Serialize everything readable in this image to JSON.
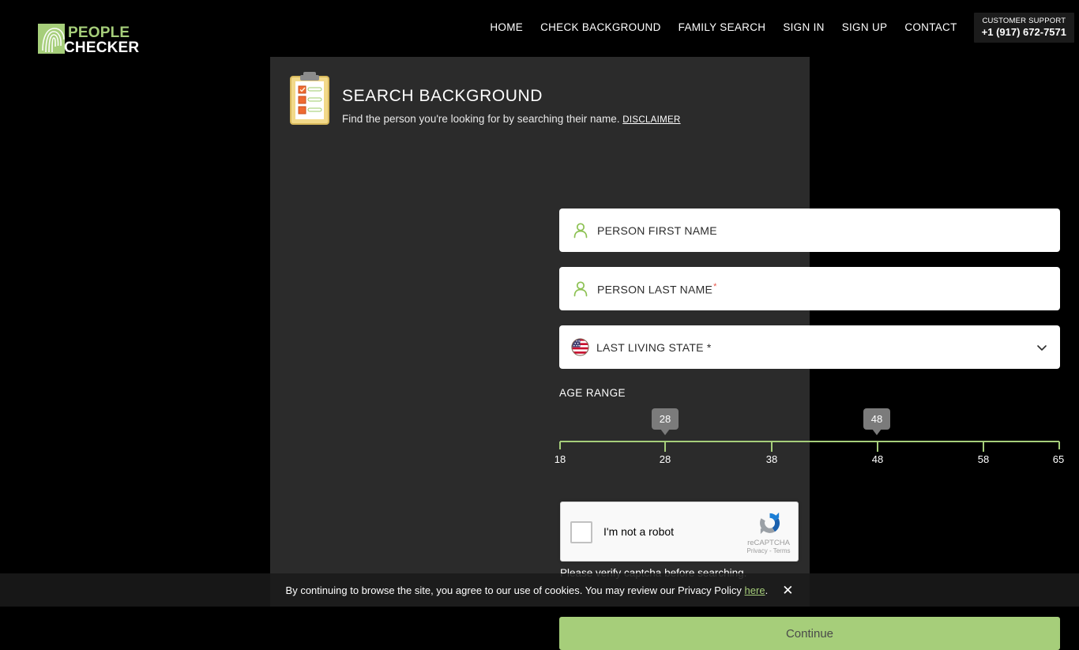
{
  "brand": {
    "name_line1": "PEOPLE",
    "name_line2": "CHECKER",
    "green": "#a6ce7a"
  },
  "nav": {
    "items": [
      {
        "label": "HOME"
      },
      {
        "label": "CHECK BACKGROUND"
      },
      {
        "label": "FAMILY SEARCH"
      },
      {
        "label": "SIGN IN"
      },
      {
        "label": "SIGN UP"
      },
      {
        "label": "CONTACT"
      }
    ],
    "support": {
      "label": "CUSTOMER SUPPORT",
      "phone": "+1 (917) 672-7571"
    }
  },
  "header": {
    "title": "SEARCH BACKGROUND",
    "subtitle": "Find the person you're looking for by searching their name.",
    "disclaimer_label": "DISCLAIMER"
  },
  "form": {
    "first_name": {
      "label": "PERSON FIRST NAME",
      "value": "",
      "required": false
    },
    "last_name": {
      "label": "PERSON LAST NAME",
      "value": "",
      "required": true,
      "required_mark": "*"
    },
    "state": {
      "label": "LAST LIVING STATE *",
      "value": ""
    }
  },
  "age_range": {
    "label": "AGE RANGE",
    "min": 18,
    "max": 65,
    "selected_min": "28",
    "selected_max": "48",
    "ticks": [
      "18",
      "28",
      "38",
      "48",
      "58",
      "65"
    ],
    "track_color": "#a6ce7a",
    "bubble_color": "#7b7b7b"
  },
  "captcha": {
    "checkbox_label": "I'm not a robot",
    "brand": "reCAPTCHA",
    "links": "Privacy - Terms",
    "error_message": "Please verify captcha before searching."
  },
  "actions": {
    "continue_label": "Continue"
  },
  "cookie_banner": {
    "text_before": "By continuing to browse the site, you agree to our use of cookies. You may review our Privacy Policy ",
    "link_label": "here",
    "text_after": ".",
    "close_label": "✕"
  }
}
